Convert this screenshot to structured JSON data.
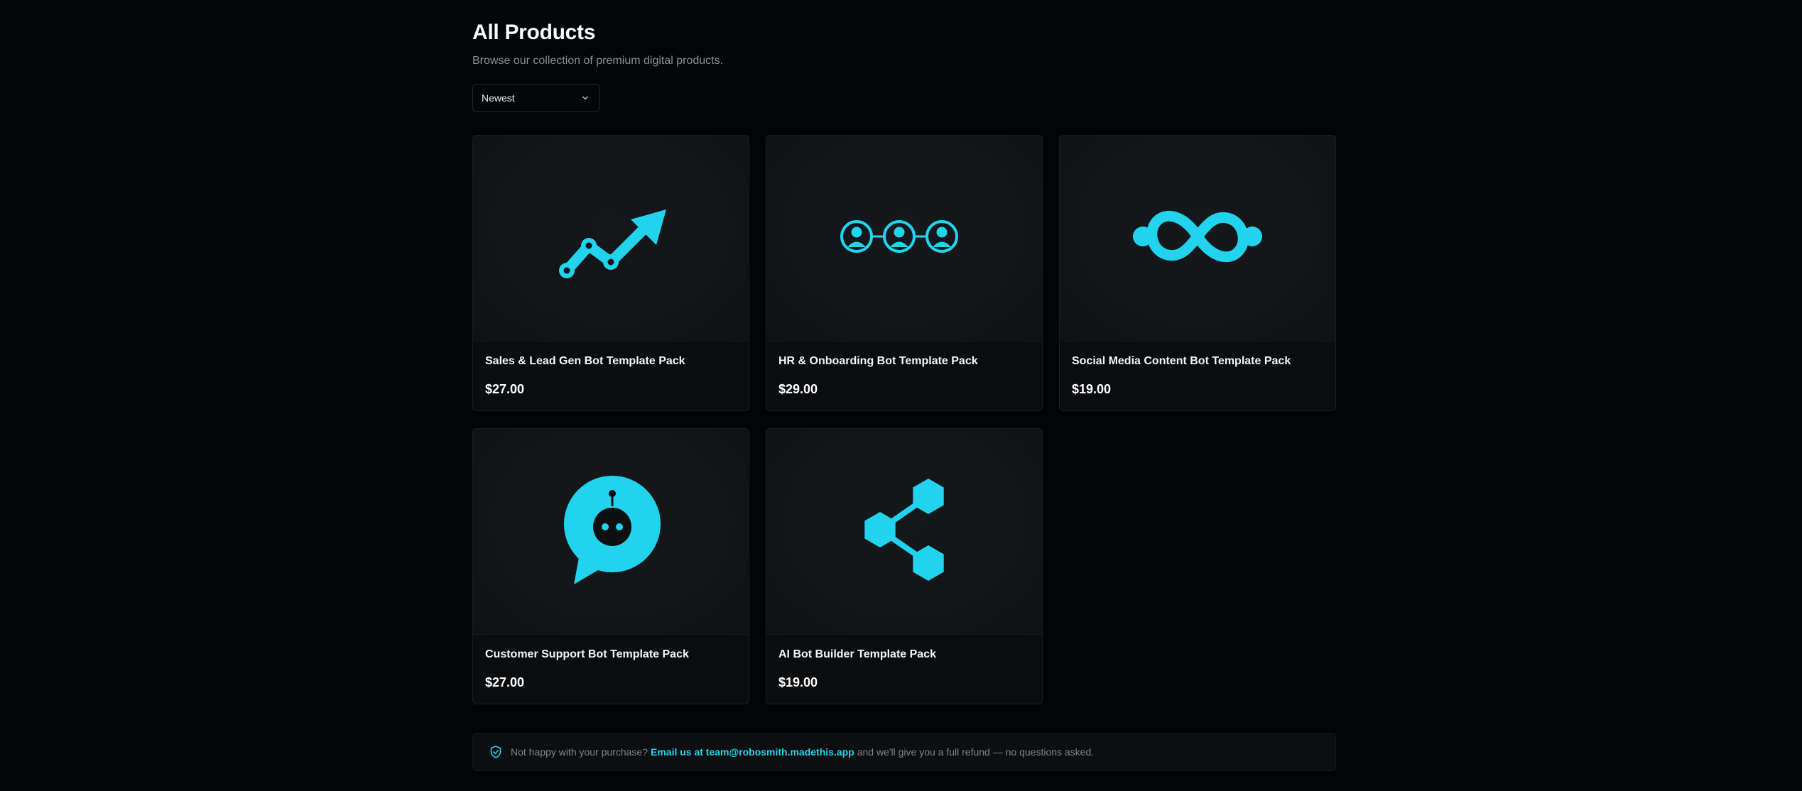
{
  "header": {
    "title": "All Products",
    "subtitle": "Browse our collection of premium digital products."
  },
  "sort": {
    "selected": "Newest",
    "icon": "chevron-down-icon"
  },
  "accent_color": "#22d3ee",
  "products": [
    {
      "name": "Sales & Lead Gen Bot Template Pack",
      "price": "$27.00",
      "icon": "trending-up-chart-icon"
    },
    {
      "name": "HR & Onboarding Bot Template Pack",
      "price": "$29.00",
      "icon": "people-network-icon"
    },
    {
      "name": "Social Media Content Bot Template Pack",
      "price": "$19.00",
      "icon": "infinity-loop-icon"
    },
    {
      "name": "Customer Support Bot Template Pack",
      "price": "$27.00",
      "icon": "robot-chat-bubble-icon"
    },
    {
      "name": "AI Bot Builder Template Pack",
      "price": "$19.00",
      "icon": "hexagon-share-icon"
    }
  ],
  "refund_notice": {
    "icon": "shield-check-icon",
    "prefix": "Not happy with your purchase?",
    "link_text": "Email us at team@robosmith.madethis.app",
    "suffix": "and we'll give you a full refund — no questions asked."
  }
}
